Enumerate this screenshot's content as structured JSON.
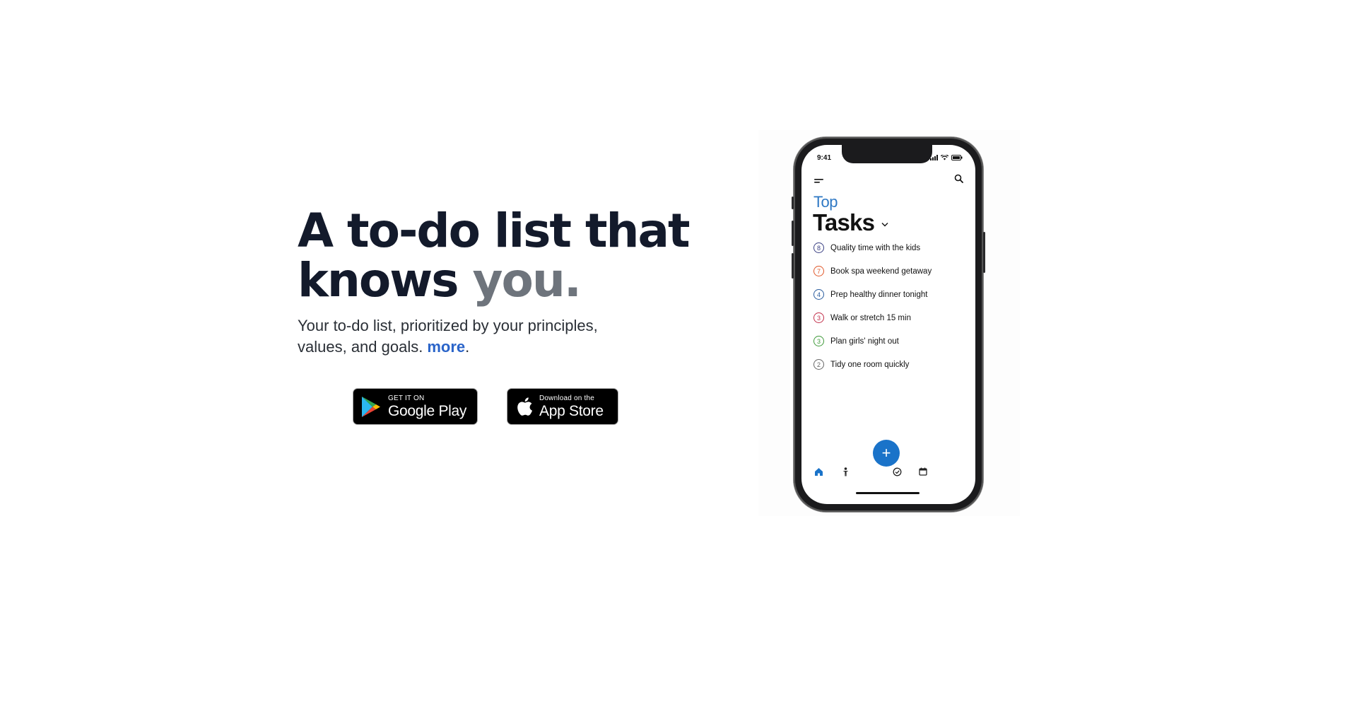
{
  "hero": {
    "headline_line1": "A to-do list that",
    "headline_line2_prefix": "knows ",
    "headline_accent": "you.",
    "subtitle": "Your to-do list, prioritized by your principles, values, and goals.",
    "more_link": "more",
    "more_suffix": "."
  },
  "stores": {
    "google_play": {
      "small": "GET IT ON",
      "big": "Google Play",
      "icon": "google-play-icon"
    },
    "app_store": {
      "small": "Download on the",
      "big": "App Store",
      "icon": "apple-icon"
    }
  },
  "phone": {
    "status_time": "9:41",
    "title_top": "Top",
    "title_main": "Tasks",
    "tasks": [
      {
        "num": "8",
        "label": "Quality time with the kids",
        "color": "#3a3f82"
      },
      {
        "num": "7",
        "label": "Book spa weekend getaway",
        "color": "#e0582a"
      },
      {
        "num": "4",
        "label": "Prep healthy dinner tonight",
        "color": "#2a5c9e"
      },
      {
        "num": "3",
        "label": "Walk or stretch 15 min",
        "color": "#c22f4a"
      },
      {
        "num": "3",
        "label": "Plan girls' night out",
        "color": "#3f9a3a"
      },
      {
        "num": "2",
        "label": "Tidy one room quickly",
        "color": "#666666"
      }
    ],
    "fab_symbol": "+",
    "nav_icons": [
      "home-icon",
      "person-icon",
      "check-circle-icon",
      "calendar-icon"
    ],
    "accent_color": "#1a73c9"
  }
}
